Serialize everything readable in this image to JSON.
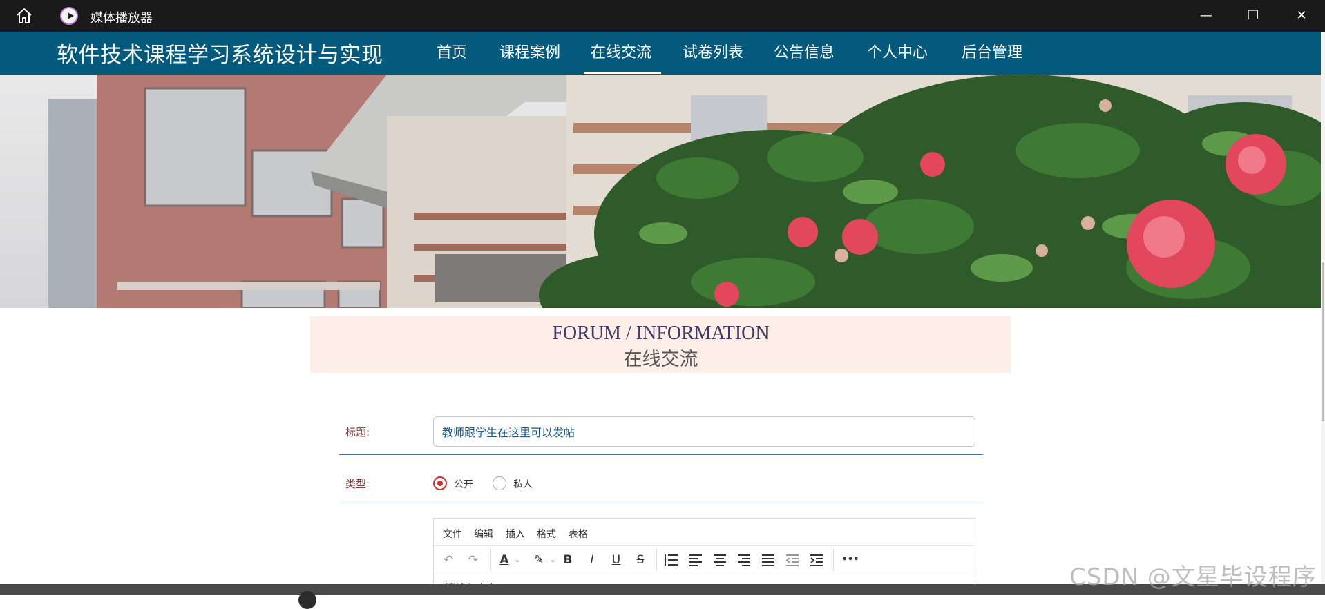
{
  "window": {
    "title": "媒体播放器",
    "home_icon": "home-icon",
    "app_icon": "media-player-icon",
    "minimize": "—",
    "maximize": "❐",
    "close": "✕"
  },
  "site": {
    "title": "软件技术课程学习系统设计与实现"
  },
  "nav": {
    "items": [
      "首页",
      "课程案例",
      "在线交流",
      "试卷列表",
      "公告信息",
      "个人中心",
      "后台管理"
    ],
    "active": "在线交流"
  },
  "banner": {
    "slide_count": 3,
    "active_slide": 3
  },
  "section": {
    "title_en": "FORUM / INFORMATION",
    "title_cn": "在线交流"
  },
  "form": {
    "title_label": "标题:",
    "title_value": "教师跟学生在这里可以发帖",
    "type_label": "类型:",
    "type_options": [
      "公开",
      "私人"
    ],
    "type_selected": "公开"
  },
  "editor": {
    "menus": [
      "文件",
      "编辑",
      "插入",
      "格式",
      "表格"
    ],
    "tools": {
      "undo": "↶",
      "redo": "↷",
      "text_color": "A",
      "highlight": "✎",
      "bold": "B",
      "italic": "I",
      "underline": "U",
      "strike": "S",
      "more": "•••"
    },
    "placeholder": "请输入内容"
  },
  "watermark": "CSDN @文星毕设程序",
  "colors": {
    "nav_bg": "#045a7c",
    "header_bg": "#fdeee8",
    "label": "#8b3a3a",
    "radio_on": "#d23030"
  }
}
